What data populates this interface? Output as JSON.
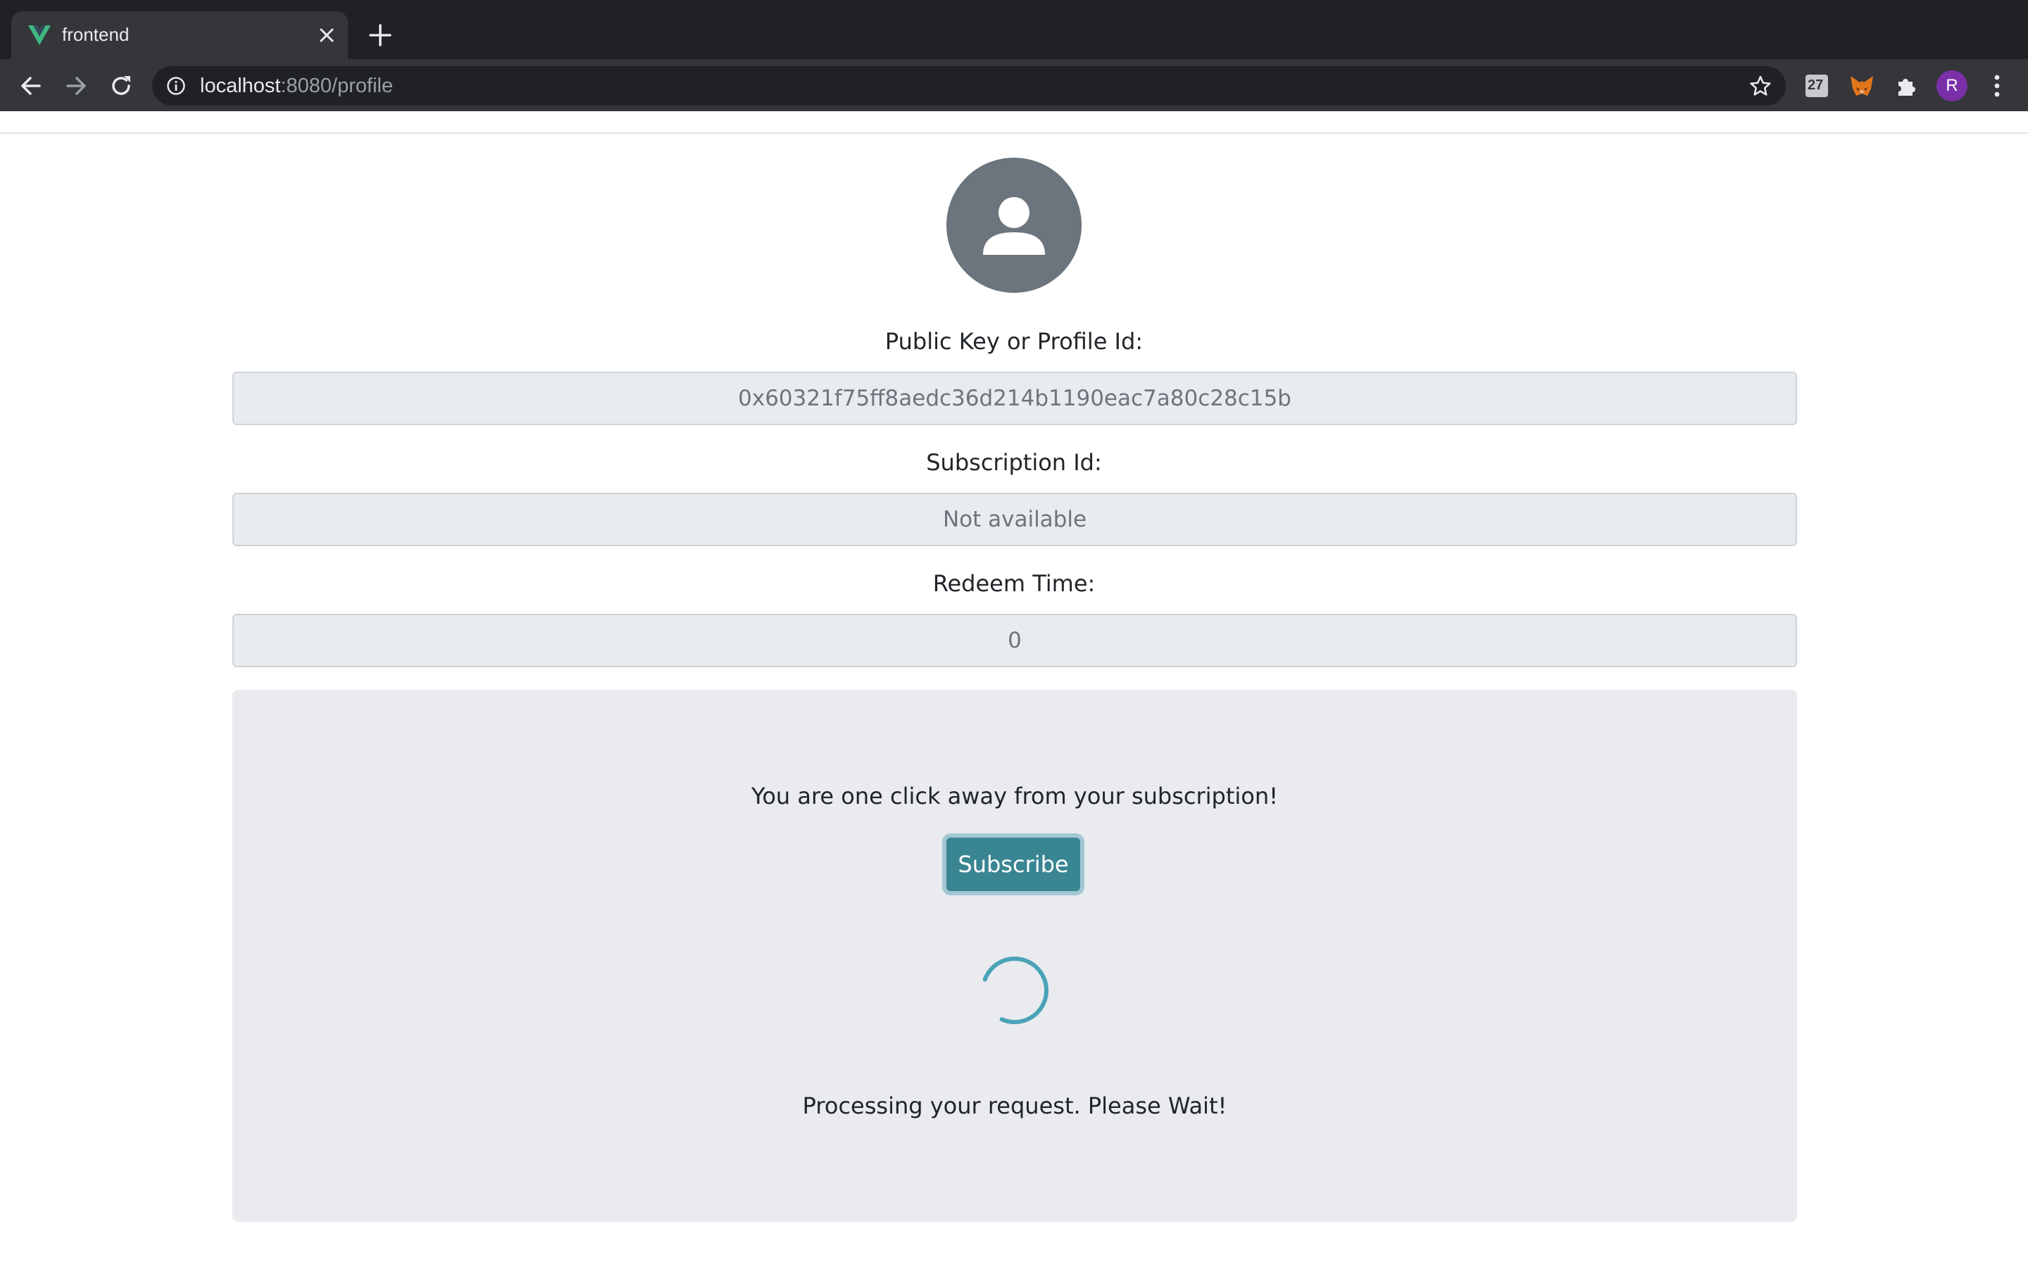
{
  "browser": {
    "tab_title": "frontend",
    "url_host": "localhost",
    "url_rest": ":8080/profile",
    "profile_initial": "R",
    "ext_badge": "27"
  },
  "profile": {
    "public_key_label": "Public Key or Profile Id:",
    "public_key_value": "0x60321f75ff8aedc36d214b1190eac7a80c28c15b",
    "subscription_label": "Subscription Id:",
    "subscription_value": "Not available",
    "redeem_label": "Redeem Time:",
    "redeem_value": "0"
  },
  "subscribe_panel": {
    "message": "You are one click away from your subscription!",
    "button_label": "Subscribe",
    "status_text": "Processing your request. Please Wait!"
  },
  "colors": {
    "accent": "#3a8592",
    "spinner": "#4aa3b7",
    "avatar_bg": "#6c757d",
    "field_bg": "#e9ecef",
    "panel_bg": "#e9ebee"
  },
  "icons": [
    "vue-logo-icon",
    "close-icon",
    "plus-icon",
    "back-arrow-icon",
    "forward-arrow-icon",
    "reload-icon",
    "info-icon",
    "star-icon",
    "extension-27-icon",
    "metamask-fox-icon",
    "puzzle-icon",
    "more-vert-icon",
    "user-icon",
    "spinner-icon"
  ]
}
